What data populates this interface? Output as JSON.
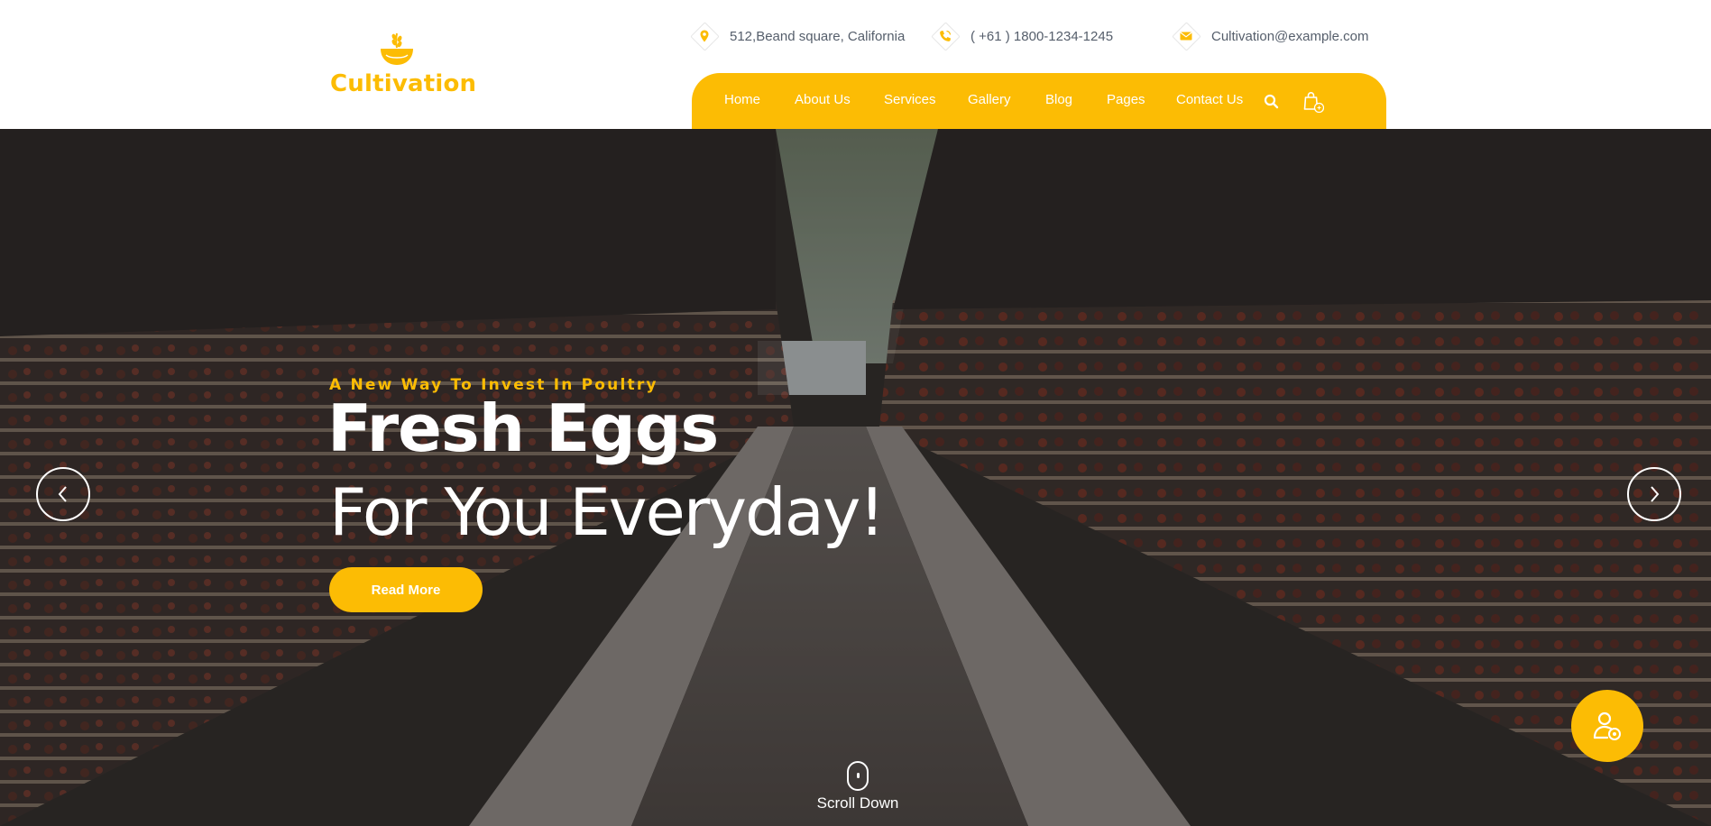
{
  "brand": {
    "name": "Cultivation",
    "accent": "#fcbc04",
    "logo_icon": "bowl-wheat-icon"
  },
  "contact": {
    "address": {
      "icon": "map-pin-icon",
      "text": "512,Beand square, California"
    },
    "phone": {
      "icon": "phone-icon",
      "text": "( +61 ) 1800-1234-1245"
    },
    "email": {
      "icon": "envelope-icon",
      "text": "Cultivation@example.com"
    }
  },
  "nav": {
    "items": [
      "Home",
      "About Us",
      "Services",
      "Gallery",
      "Blog",
      "Pages",
      "Contact Us"
    ],
    "search_icon": "search-icon",
    "cart_icon": "shopping-bag-icon"
  },
  "hero": {
    "subtitle": "A New Way To Invest In Poultry",
    "title_line1": "Fresh Eggs",
    "title_line2": "For You Everyday!",
    "cta": "Read More",
    "prev_icon": "chevron-left-icon",
    "next_icon": "chevron-right-icon",
    "scroll_label": "Scroll Down",
    "scroll_icon": "mouse-icon"
  },
  "floating_button": {
    "icon": "user-support-icon"
  }
}
